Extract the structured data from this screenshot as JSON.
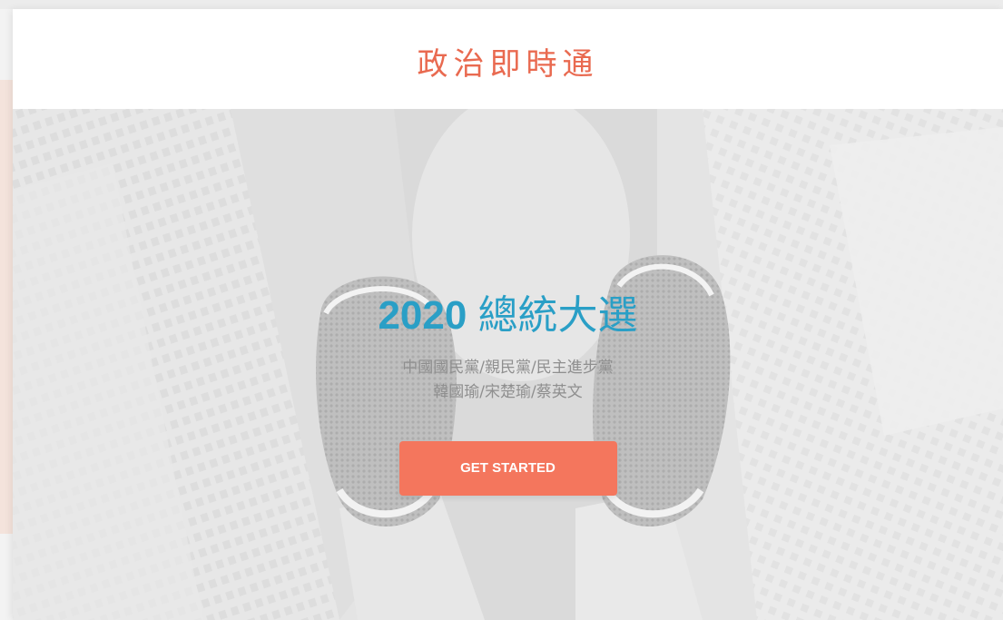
{
  "header": {
    "logo_text": "政治即時通"
  },
  "hero": {
    "title_number": "2020",
    "title_text": "總統大選",
    "line1": "中國國民黨/親民黨/民主進步黨",
    "line2": "韓國瑜/宋楚瑜/蔡英文",
    "cta_label": "GET STARTED"
  },
  "colors": {
    "brand": "#e96a50",
    "title": "#2a9fc6",
    "cta": "#f4765d",
    "subtitle": "#8f8f8f"
  }
}
